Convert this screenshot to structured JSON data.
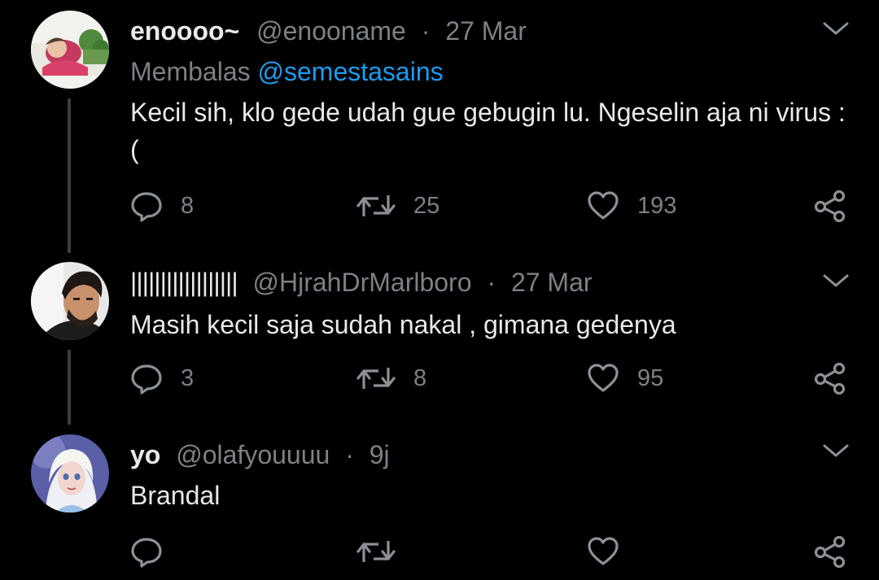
{
  "colors": {
    "background": "#000000",
    "text": "#e7e9ea",
    "secondary": "#7b8186",
    "link": "#1d9bf0",
    "thread_line": "#3a3d41"
  },
  "tweets": [
    {
      "name": "enoooo~",
      "handle": "@enooname",
      "separator": "·",
      "time": "27 Mar",
      "reply_prefix": "Membalas",
      "reply_mention": "@semestasains",
      "text": "Kecil sih, klo gede udah gue gebugin lu. Ngeselin aja ni virus :(",
      "replies": "8",
      "retweets": "25",
      "likes": "193",
      "icons": [
        "reply-icon",
        "retweet-icon",
        "like-icon",
        "share-icon",
        "chevron-down-icon"
      ]
    },
    {
      "name": "||||||||||||||||||",
      "handle": "@HjrahDrMarlboro",
      "separator": "·",
      "time": "27 Mar",
      "text": "Masih kecil saja sudah nakal , gimana gedenya",
      "replies": "3",
      "retweets": "8",
      "likes": "95",
      "icons": [
        "reply-icon",
        "retweet-icon",
        "like-icon",
        "share-icon",
        "chevron-down-icon"
      ]
    },
    {
      "name": "yo",
      "handle": "@olafyouuuu",
      "separator": "·",
      "time": "9j",
      "text": "Brandal",
      "replies": "",
      "retweets": "",
      "likes": "",
      "icons": [
        "reply-icon",
        "retweet-icon",
        "like-icon",
        "share-icon",
        "chevron-down-icon"
      ]
    }
  ]
}
